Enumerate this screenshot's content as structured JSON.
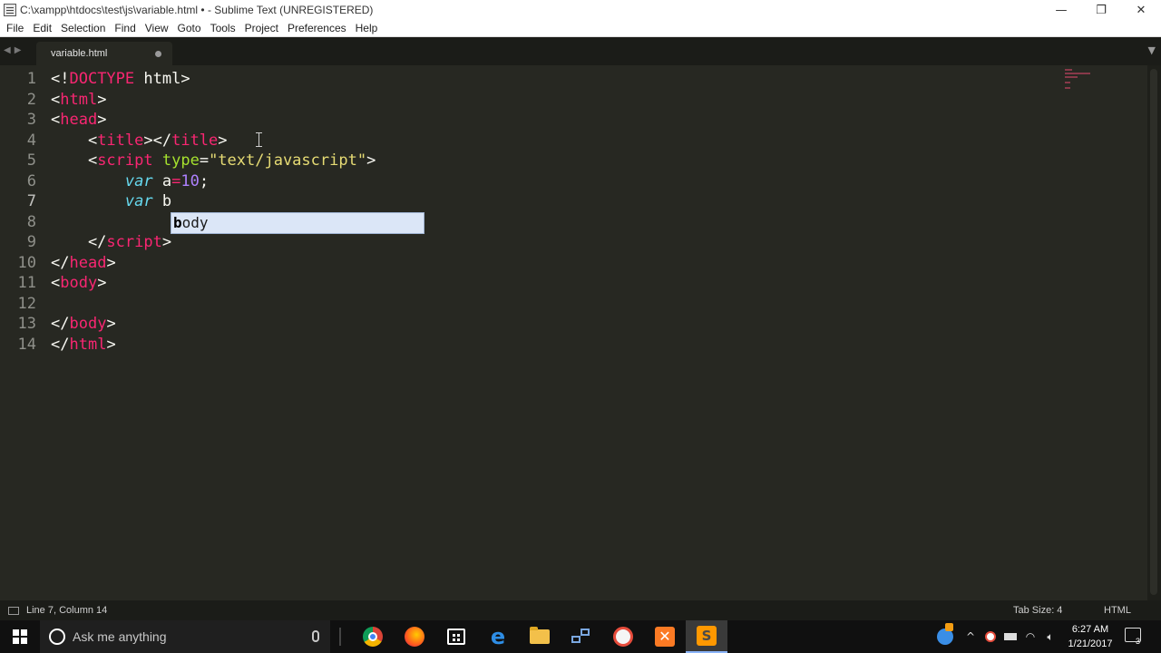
{
  "window": {
    "title": "C:\\xampp\\htdocs\\test\\js\\variable.html • - Sublime Text (UNREGISTERED)",
    "minimize": "—",
    "restore": "❐",
    "close": "✕"
  },
  "menu": [
    "File",
    "Edit",
    "Selection",
    "Find",
    "View",
    "Goto",
    "Tools",
    "Project",
    "Preferences",
    "Help"
  ],
  "tab": {
    "label": "variable.html"
  },
  "editor": {
    "line_numbers": [
      "1",
      "2",
      "3",
      "4",
      "5",
      "6",
      "7",
      "8",
      "9",
      "10",
      "11",
      "12",
      "13",
      "14"
    ],
    "active_line": 7
  },
  "autocomplete": {
    "match": "b",
    "rest": "ody"
  },
  "status": {
    "position": "Line 7, Column 14",
    "tab_size": "Tab Size: 4",
    "syntax": "HTML"
  },
  "taskbar": {
    "search_placeholder": "Ask me anything",
    "time": "6:27 AM",
    "date": "1/21/2017",
    "notifications": "3"
  },
  "colors": {
    "background": "#272822",
    "tag": "#f92672",
    "attribute": "#a6e22e",
    "string": "#e6db74",
    "keyword": "#66d9ef",
    "number": "#ae81ff"
  }
}
